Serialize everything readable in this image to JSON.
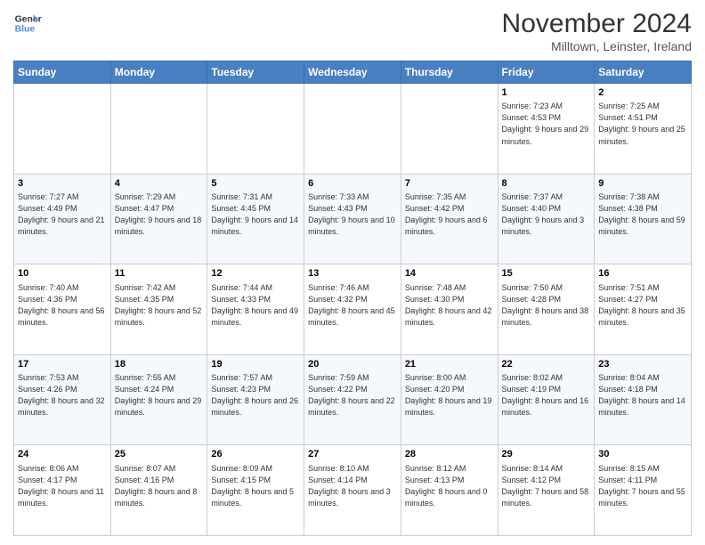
{
  "logo": {
    "line1": "General",
    "line2": "Blue"
  },
  "title": "November 2024",
  "location": "Milltown, Leinster, Ireland",
  "days_of_week": [
    "Sunday",
    "Monday",
    "Tuesday",
    "Wednesday",
    "Thursday",
    "Friday",
    "Saturday"
  ],
  "weeks": [
    [
      {
        "day": "",
        "info": ""
      },
      {
        "day": "",
        "info": ""
      },
      {
        "day": "",
        "info": ""
      },
      {
        "day": "",
        "info": ""
      },
      {
        "day": "",
        "info": ""
      },
      {
        "day": "1",
        "info": "Sunrise: 7:23 AM\nSunset: 4:53 PM\nDaylight: 9 hours and 29 minutes."
      },
      {
        "day": "2",
        "info": "Sunrise: 7:25 AM\nSunset: 4:51 PM\nDaylight: 9 hours and 25 minutes."
      }
    ],
    [
      {
        "day": "3",
        "info": "Sunrise: 7:27 AM\nSunset: 4:49 PM\nDaylight: 9 hours and 21 minutes."
      },
      {
        "day": "4",
        "info": "Sunrise: 7:29 AM\nSunset: 4:47 PM\nDaylight: 9 hours and 18 minutes."
      },
      {
        "day": "5",
        "info": "Sunrise: 7:31 AM\nSunset: 4:45 PM\nDaylight: 9 hours and 14 minutes."
      },
      {
        "day": "6",
        "info": "Sunrise: 7:33 AM\nSunset: 4:43 PM\nDaylight: 9 hours and 10 minutes."
      },
      {
        "day": "7",
        "info": "Sunrise: 7:35 AM\nSunset: 4:42 PM\nDaylight: 9 hours and 6 minutes."
      },
      {
        "day": "8",
        "info": "Sunrise: 7:37 AM\nSunset: 4:40 PM\nDaylight: 9 hours and 3 minutes."
      },
      {
        "day": "9",
        "info": "Sunrise: 7:38 AM\nSunset: 4:38 PM\nDaylight: 8 hours and 59 minutes."
      }
    ],
    [
      {
        "day": "10",
        "info": "Sunrise: 7:40 AM\nSunset: 4:36 PM\nDaylight: 8 hours and 56 minutes."
      },
      {
        "day": "11",
        "info": "Sunrise: 7:42 AM\nSunset: 4:35 PM\nDaylight: 8 hours and 52 minutes."
      },
      {
        "day": "12",
        "info": "Sunrise: 7:44 AM\nSunset: 4:33 PM\nDaylight: 8 hours and 49 minutes."
      },
      {
        "day": "13",
        "info": "Sunrise: 7:46 AM\nSunset: 4:32 PM\nDaylight: 8 hours and 45 minutes."
      },
      {
        "day": "14",
        "info": "Sunrise: 7:48 AM\nSunset: 4:30 PM\nDaylight: 8 hours and 42 minutes."
      },
      {
        "day": "15",
        "info": "Sunrise: 7:50 AM\nSunset: 4:28 PM\nDaylight: 8 hours and 38 minutes."
      },
      {
        "day": "16",
        "info": "Sunrise: 7:51 AM\nSunset: 4:27 PM\nDaylight: 8 hours and 35 minutes."
      }
    ],
    [
      {
        "day": "17",
        "info": "Sunrise: 7:53 AM\nSunset: 4:26 PM\nDaylight: 8 hours and 32 minutes."
      },
      {
        "day": "18",
        "info": "Sunrise: 7:55 AM\nSunset: 4:24 PM\nDaylight: 8 hours and 29 minutes."
      },
      {
        "day": "19",
        "info": "Sunrise: 7:57 AM\nSunset: 4:23 PM\nDaylight: 8 hours and 26 minutes."
      },
      {
        "day": "20",
        "info": "Sunrise: 7:59 AM\nSunset: 4:22 PM\nDaylight: 8 hours and 22 minutes."
      },
      {
        "day": "21",
        "info": "Sunrise: 8:00 AM\nSunset: 4:20 PM\nDaylight: 8 hours and 19 minutes."
      },
      {
        "day": "22",
        "info": "Sunrise: 8:02 AM\nSunset: 4:19 PM\nDaylight: 8 hours and 16 minutes."
      },
      {
        "day": "23",
        "info": "Sunrise: 8:04 AM\nSunset: 4:18 PM\nDaylight: 8 hours and 14 minutes."
      }
    ],
    [
      {
        "day": "24",
        "info": "Sunrise: 8:06 AM\nSunset: 4:17 PM\nDaylight: 8 hours and 11 minutes."
      },
      {
        "day": "25",
        "info": "Sunrise: 8:07 AM\nSunset: 4:16 PM\nDaylight: 8 hours and 8 minutes."
      },
      {
        "day": "26",
        "info": "Sunrise: 8:09 AM\nSunset: 4:15 PM\nDaylight: 8 hours and 5 minutes."
      },
      {
        "day": "27",
        "info": "Sunrise: 8:10 AM\nSunset: 4:14 PM\nDaylight: 8 hours and 3 minutes."
      },
      {
        "day": "28",
        "info": "Sunrise: 8:12 AM\nSunset: 4:13 PM\nDaylight: 8 hours and 0 minutes."
      },
      {
        "day": "29",
        "info": "Sunrise: 8:14 AM\nSunset: 4:12 PM\nDaylight: 7 hours and 58 minutes."
      },
      {
        "day": "30",
        "info": "Sunrise: 8:15 AM\nSunset: 4:11 PM\nDaylight: 7 hours and 55 minutes."
      }
    ]
  ]
}
